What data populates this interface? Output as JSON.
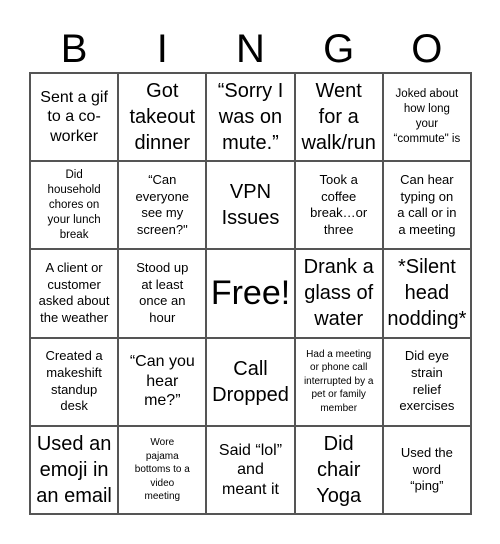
{
  "header": {
    "letters": [
      "B",
      "I",
      "N",
      "G",
      "O"
    ]
  },
  "board": {
    "rows": [
      [
        {
          "text": "Sent a gif\nto a co-\nworker",
          "size": "m"
        },
        {
          "text": "Got\ntakeout\ndinner",
          "size": "l"
        },
        {
          "text": "“Sorry I\nwas on\nmute.”",
          "size": "l"
        },
        {
          "text": "Went\nfor a\nwalk/run",
          "size": "l"
        },
        {
          "text": "Joked about\nhow long\nyour\n“commute\" is",
          "size": "xs"
        }
      ],
      [
        {
          "text": "Did\nhousehold\nchores on\nyour lunch\nbreak",
          "size": "xs"
        },
        {
          "text": "“Can\neveryone\nsee my\nscreen?\"",
          "size": "s"
        },
        {
          "text": "VPN\nIssues",
          "size": "l"
        },
        {
          "text": "Took a\ncoffee\nbreak…or\nthree",
          "size": "s"
        },
        {
          "text": "Can hear\ntyping on\na call or in\na meeting",
          "size": "s"
        }
      ],
      [
        {
          "text": "A client or\ncustomer\nasked about\nthe weather",
          "size": "s"
        },
        {
          "text": "Stood up\nat least\nonce an\nhour",
          "size": "s"
        },
        {
          "text": "Free!",
          "size": "xl"
        },
        {
          "text": "Drank a\nglass of\nwater",
          "size": "l"
        },
        {
          "text": "*Silent\nhead\nnodding*",
          "size": "l"
        }
      ],
      [
        {
          "text": "Created a\nmakeshift\nstandup\ndesk",
          "size": "s"
        },
        {
          "text": "“Can you\nhear\nme?”",
          "size": "m"
        },
        {
          "text": "Call\nDropped",
          "size": "l"
        },
        {
          "text": "Had a meeting\nor phone call\ninterrupted by a\npet or family\nmember",
          "size": "xxs"
        },
        {
          "text": "Did eye\nstrain\nrelief\nexercises",
          "size": "s"
        }
      ],
      [
        {
          "text": "Used an\nemoji in\nan email",
          "size": "l"
        },
        {
          "text": "Wore\npajama\nbottoms to a\nvideo\nmeeting",
          "size": "xxs"
        },
        {
          "text": "Said “lol”\nand\nmeant it",
          "size": "m"
        },
        {
          "text": "Did\nchair\nYoga",
          "size": "l"
        },
        {
          "text": "Used the\nword\n“ping”",
          "size": "s"
        }
      ]
    ]
  }
}
